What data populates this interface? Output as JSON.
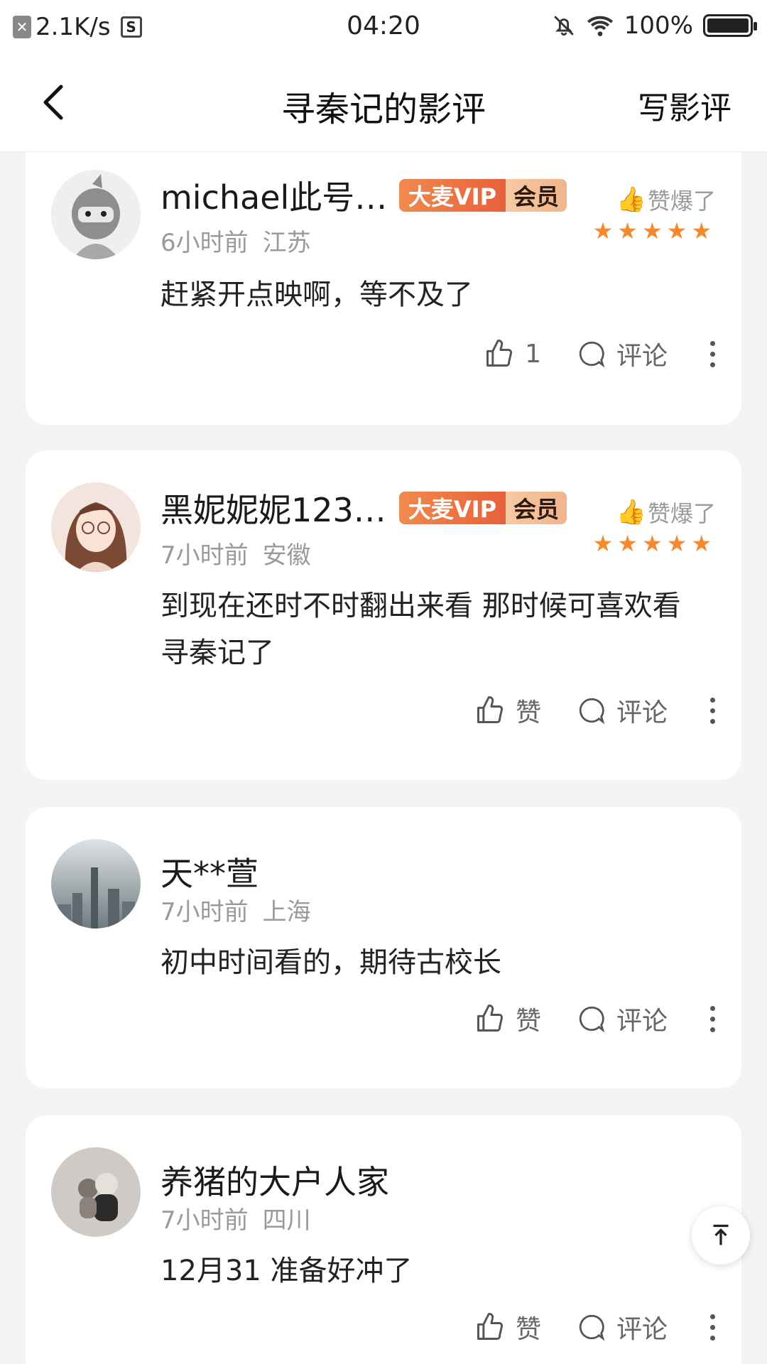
{
  "status_bar": {
    "speed": "2.1K/s",
    "time": "04:20",
    "battery": "100%"
  },
  "header": {
    "title": "寻秦记的影评",
    "write_label": "写影评"
  },
  "reviews": [
    {
      "name": "michael此号…",
      "vip_a": "大麦VIP",
      "vip_b": "会员",
      "hot": "赞爆了",
      "time": "6小时前",
      "location": "江苏",
      "content": "赶紧开点映啊，等不及了",
      "like_label": "1",
      "comment_label": "评论",
      "rating": 5
    },
    {
      "name": "黑妮妮妮123…",
      "vip_a": "大麦VIP",
      "vip_b": "会员",
      "hot": "赞爆了",
      "time": "7小时前",
      "location": "安徽",
      "content": "到现在还时不时翻出来看 那时候可喜欢看寻秦记了",
      "like_label": "赞",
      "comment_label": "评论",
      "rating": 5
    },
    {
      "name": "天**萱",
      "time": "7小时前",
      "location": "上海",
      "content": "初中时间看的，期待古校长",
      "like_label": "赞",
      "comment_label": "评论"
    },
    {
      "name": "养猪的大户人家",
      "time": "7小时前",
      "location": "四川",
      "content": "12月31 准备好冲了",
      "like_label": "赞",
      "comment_label": "评论"
    }
  ]
}
